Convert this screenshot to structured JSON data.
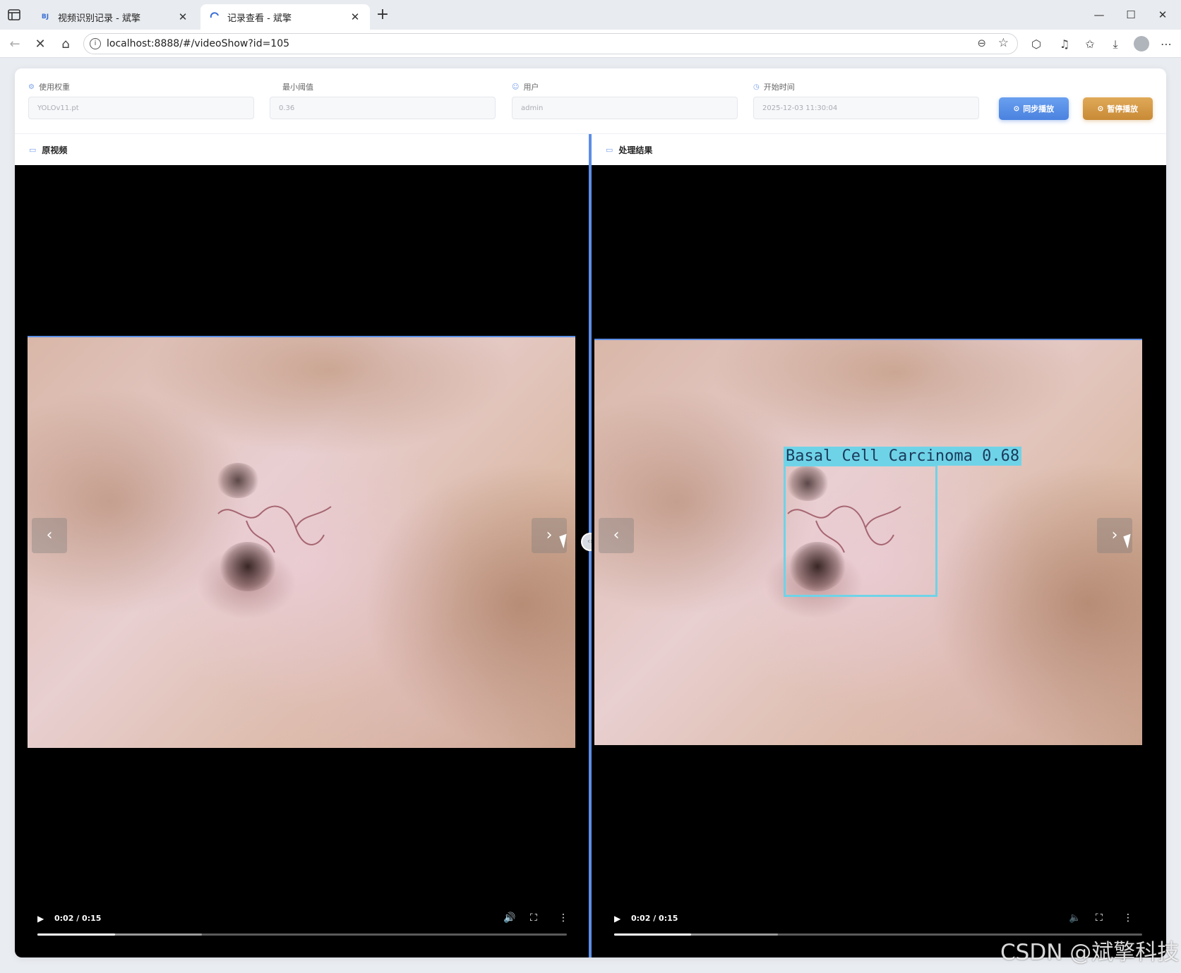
{
  "browser": {
    "tabs": [
      {
        "favicon": "BJ",
        "title": "视频识别记录 - 斌擎",
        "active": false
      },
      {
        "favicon": "loading",
        "title": "记录查看 - 斌擎",
        "active": true
      }
    ],
    "url": "localhost:8888/#/videoShow?id=105"
  },
  "info": {
    "weights": {
      "label": "使用权重",
      "value": "YOLOv11.pt",
      "icon": "cube-icon"
    },
    "threshold": {
      "label": "最小阈值",
      "value": "0.36"
    },
    "user": {
      "label": "用户",
      "value": "admin",
      "icon": "user-icon"
    },
    "start_time": {
      "label": "开始时间",
      "value": "2025-12-03 11:30:04",
      "icon": "clock-icon"
    }
  },
  "buttons": {
    "sync_play": "同步播放",
    "pause_play": "暂停播放"
  },
  "panels": {
    "original": {
      "title": "原视频",
      "time": "0:02 / 0:15",
      "progress": 0.146,
      "buffered": 0.31
    },
    "result": {
      "title": "处理结果",
      "time": "0:02 / 0:15",
      "progress": 0.146,
      "buffered": 0.31
    }
  },
  "detection": {
    "label": "Basal Cell Carcinoma 0.68",
    "color": "#6fd3e8"
  },
  "colors": {
    "accent": "#5b8fe6",
    "sync_button": "#4a82df",
    "pause_button": "#c88a36"
  },
  "watermark": "CSDN @斌擎科技"
}
